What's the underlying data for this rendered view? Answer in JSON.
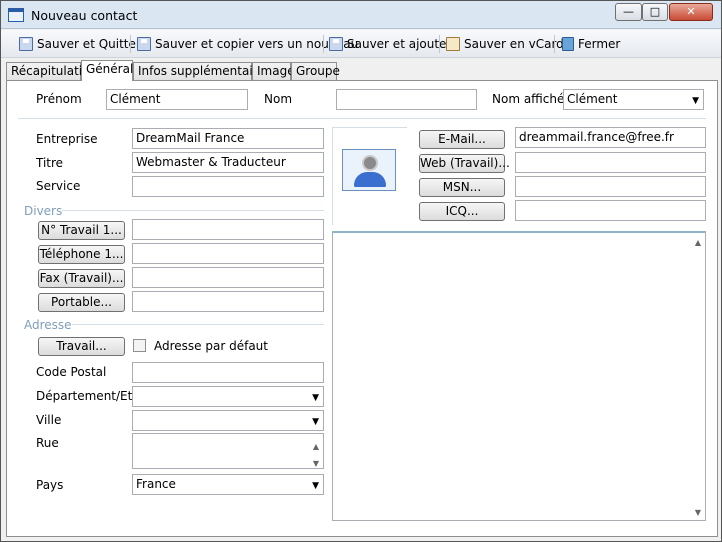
{
  "window": {
    "title": "Nouveau contact",
    "min": "—",
    "max": "□",
    "close": "✕"
  },
  "toolbar": {
    "save_quit": "Sauver et Quitter",
    "save_copy": "Sauver et copier vers un nouveau",
    "save_add": "Sauver et ajouter",
    "save_vcard": "Sauver en vCard",
    "close": "Fermer"
  },
  "tabs": [
    "Récapitulatif",
    "Général",
    "Infos supplémentaires",
    "Image",
    "Groupe"
  ],
  "name_row": {
    "prenom_label": "Prénom",
    "prenom_value": "Clément",
    "nom_label": "Nom",
    "nom_value": "",
    "display_label": "Nom affiché",
    "display_value": "Clément"
  },
  "company": {
    "entreprise_label": "Entreprise",
    "entreprise_value": "DreamMail France",
    "titre_label": "Titre",
    "titre_value": "Webmaster & Traducteur",
    "service_label": "Service",
    "service_value": ""
  },
  "divers": {
    "title": "Divers",
    "buttons": [
      "N° Travail 1...",
      "Téléphone 1...",
      "Fax (Travail)...",
      "Portable..."
    ],
    "values": [
      "",
      "",
      "",
      ""
    ]
  },
  "adresse": {
    "title": "Adresse",
    "travail_button": "Travail...",
    "default_checkbox": "Adresse par défaut",
    "code_postal_label": "Code Postal",
    "departement_label": "Département/Etat",
    "ville_label": "Ville",
    "rue_label": "Rue",
    "pays_label": "Pays",
    "pays_value": "France"
  },
  "online": {
    "buttons": [
      "E-Mail...",
      "Web (Travail)...",
      "MSN...",
      "ICQ..."
    ],
    "values": [
      "dreammail.france@free.fr",
      "",
      "",
      ""
    ]
  }
}
